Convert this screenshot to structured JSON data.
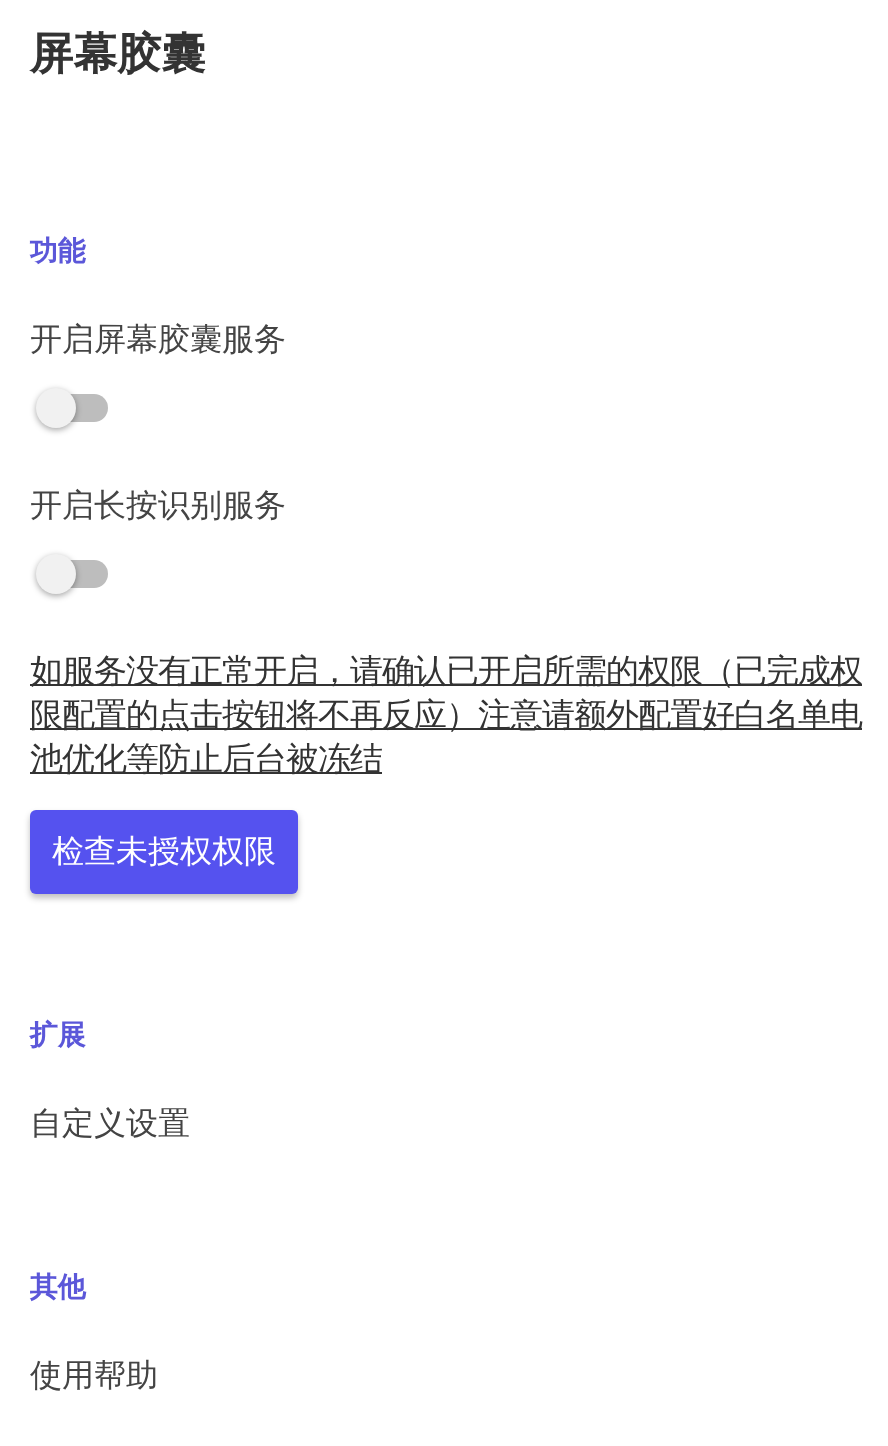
{
  "title": "屏幕胶囊",
  "sections": [
    {
      "header": "功能",
      "items": [
        {
          "kind": "switch",
          "label": "开启屏幕胶囊服务",
          "on": false
        },
        {
          "kind": "switch",
          "label": "开启长按识别服务",
          "on": false
        },
        {
          "kind": "note",
          "text": "如服务没有正常开启，请确认已开启所需的权限（已完成权限配置的点击按钮将不再反应）注意请额外配置好白名单电池优化等防止后台被冻结"
        },
        {
          "kind": "button",
          "label": "检查未授权权限"
        }
      ]
    },
    {
      "header": "扩展",
      "items": [
        {
          "kind": "link",
          "label": "自定义设置"
        }
      ]
    },
    {
      "header": "其他",
      "items": [
        {
          "kind": "link",
          "label": "使用帮助"
        }
      ]
    }
  ]
}
